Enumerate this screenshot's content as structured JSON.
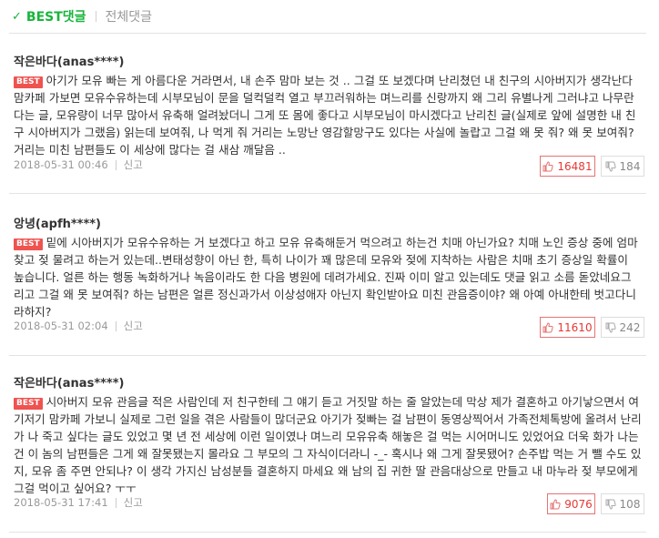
{
  "tabs": {
    "best": "BEST댓글",
    "all": "전체댓글"
  },
  "badge_label": "BEST",
  "report_label": "신고",
  "colors": {
    "accent": "#18b53b",
    "badge": "#ef5350",
    "like": "#e53935"
  },
  "comments": [
    {
      "author": "작은바다(anas****)",
      "text": "아기가 모유 빠는 게 아름다운 거라면서, 내 손주 맘마 보는 것 .. 그걸 또 보겠다며 난리쳤던 내 친구의 시아버지가 생각난다 맘카페 가보면 모유수유하는데 시부모님이 문을 덜컥덜컥 열고 부끄러워하는 며느리를 신랑까지 왜 그리 유별나게 그러냐고 나무란다는 글, 모유량이 너무 많아서 유축해 얼려놨더니 그게 또 몸에 좋다고 시부모님이 마시겠다고 난리친 글(실제로 앞에 설명한 내 친구 시아버지가 그랬음) 읽는데 보여줘, 나 먹게 줘 거리는 노망난 영감할망구도 있다는 사실에 놀랍고 그걸 왜 못 줘? 왜 못 보여줘? 거리는 미친 남편들도 이 세상에 많다는 걸 새삼 깨달음 ..",
      "date": "2018-05-31 00:46",
      "likes": "16481",
      "dislikes": "184"
    },
    {
      "author": "앙녕(apfh****)",
      "text": "밑에 시아버지가 모유수유하는 거 보겠다고 하고 모유 유축해둔거 먹으려고 하는건 치매 아닌가요? 치매 노인 증상 중에 엄마 찾고 젖 물려고 하는거 있는데..변태성향이 아닌 한, 특히 나이가 꽤 많은데 모유와 젖에 지착하는 사람은 치매 초기 증상일 확률이 높습니다. 얼른 하는 행동 녹화하거나 녹음이라도 한 다음 병원에 데려가세요. 진짜 이미 알고 있는데도 댓글 읽고 소름 돋았네요그리고 그걸 왜 못 보여줘? 하는 남편은 얼른 정신과가서 이상성애자 아닌지 확인받아요 미친 관음증이야? 왜 아예 아내한테 벗고다니라하지?",
      "date": "2018-05-31 02:04",
      "likes": "11610",
      "dislikes": "242"
    },
    {
      "author": "작은바다(anas****)",
      "text": "시아버지 모유 관음글 적은 사람인데 저 친구한테 그 얘기 듣고 거짓말 하는 줄 알았는데 막상 제가 결혼하고 아기낳으면서 여기저기 맘카페 가보니 실제로 그런 일을 겪은 사람들이 많더군요 아기가 젖빠는 걸 남편이 동영상찍어서 가족전체톡방에 올려서 난리가 나 죽고 싶다는 글도 있었고 몇 년 전 세상에 이런 일이였나 며느리 모유유축 해놓은 걸 먹는 시어머니도 있었어요 더욱 화가 나는 건 이 놈의 남편들은 그게 왜 잘못됐는지 몰라요 그 부모의 그 자식이더라니 -_- 혹시나 왜 그게 잘못됐어? 손주밥 먹는 거 뺄 수도 있지, 모유 좀 주면 안되나? 이 생각 가지신 남성분들 결혼하지 마세요 왜 남의 집 귀한 딸 관음대상으로 만들고 내 마누라 젖 부모에게 그걸 먹이고 싶어요? ㅜㅜ",
      "date": "2018-05-31 17:41",
      "likes": "9076",
      "dislikes": "108"
    }
  ]
}
